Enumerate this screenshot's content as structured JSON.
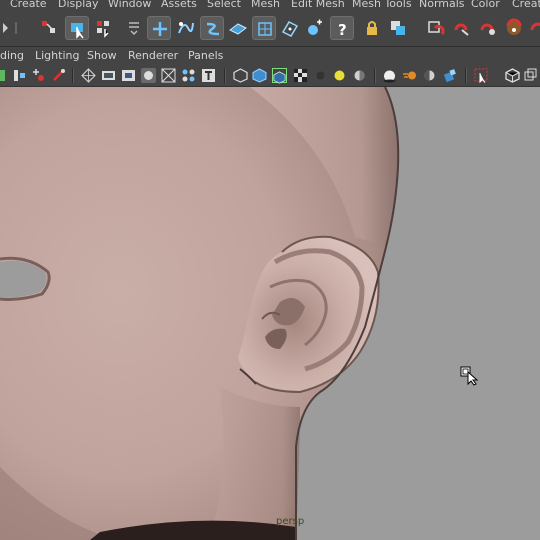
{
  "menubar": {
    "items": [
      "Create",
      "Display",
      "Window",
      "Assets",
      "Select",
      "Mesh",
      "Edit Mesh",
      "Mesh Tools",
      "Normals",
      "Color",
      "Creat"
    ]
  },
  "panel_menu": {
    "items": [
      "ding",
      "Lighting",
      "Show",
      "Renderer",
      "Panels"
    ]
  },
  "viewport": {
    "camera_label": "persp",
    "background": "#9c9c9c",
    "skin_color": "#c4a9a2"
  },
  "icons": {
    "shelf": [
      "arrow-icon",
      "select-icon",
      "lasso-select-icon",
      "paint-select-icon",
      "soft-select-icon",
      "insert-edge-icon",
      "multi-cut-icon",
      "quad-draw-icon",
      "bridge-icon",
      "extrude-icon",
      "bevel-icon",
      "merge-icon",
      "help-icon",
      "lock-icon",
      "copy-icon",
      "magnet-grid-icon",
      "magnet-curve-icon",
      "magnet-point-icon",
      "magnet-surface-icon"
    ],
    "panel": [
      "camera-attr-icon",
      "image-plane-icon",
      "grid-toggle-icon",
      "film-gate-icon",
      "resolution-gate-icon",
      "gate-mask-icon",
      "field-chart-icon",
      "safe-title-icon",
      "wireframe-icon",
      "smooth-shade-icon",
      "wireframe-on-shaded-icon",
      "textured-icon",
      "default-light-icon",
      "shadow-icon",
      "ambient-occlusion-icon",
      "motion-blur-icon",
      "antialias-icon",
      "isolate-select-icon",
      "xray-icon",
      "xray-joints-icon"
    ]
  }
}
